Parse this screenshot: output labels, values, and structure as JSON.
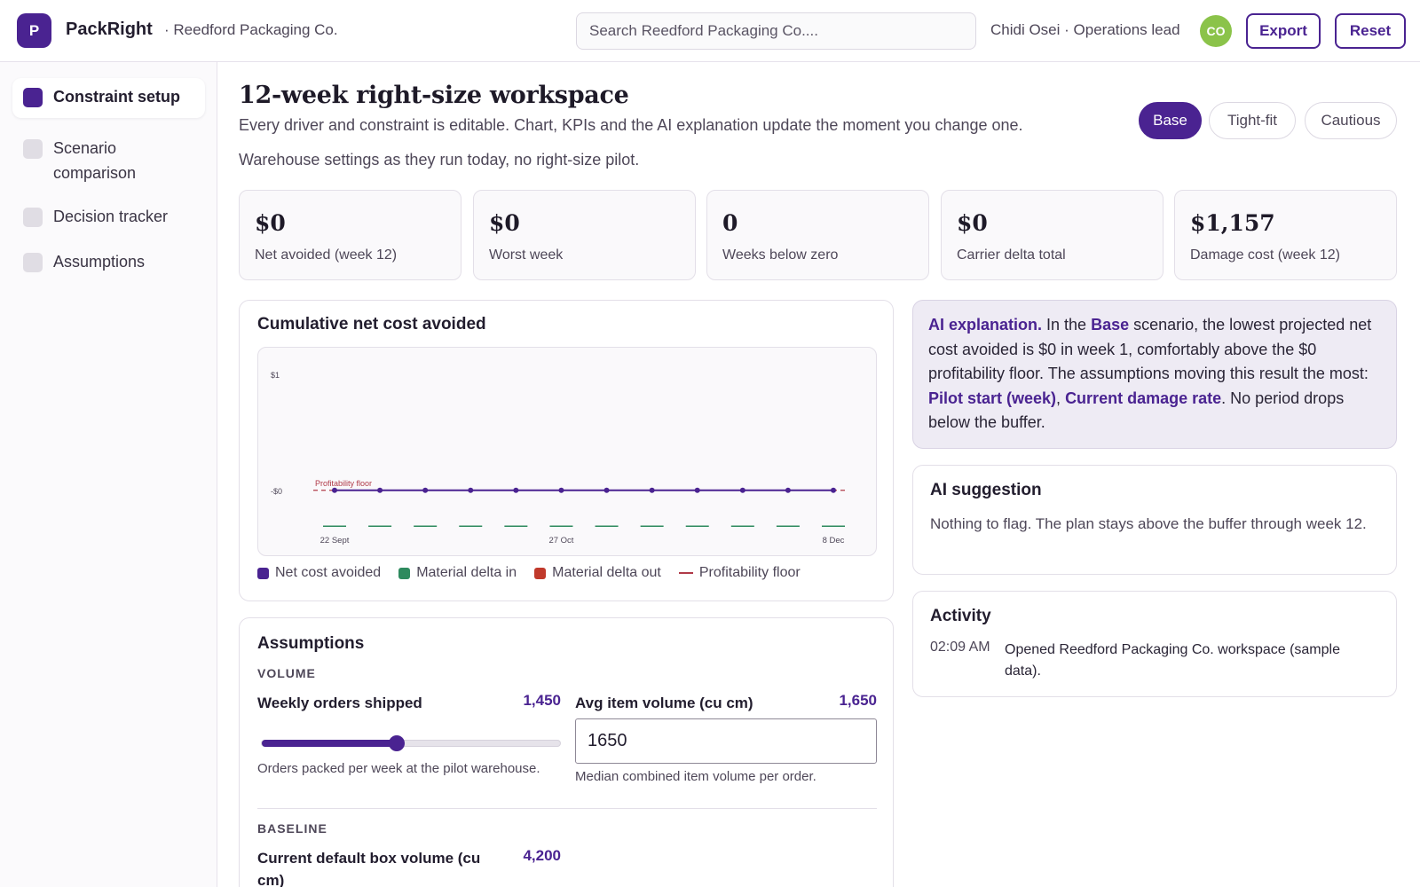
{
  "header": {
    "logo_letter": "P",
    "app_name": "PackRight",
    "org_name": "· Reedford Packaging Co.",
    "search_placeholder": "Search Reedford Packaging Co....",
    "user": "Chidi Osei · Operations lead",
    "avatar_initials": "CO",
    "export_label": "Export",
    "reset_label": "Reset"
  },
  "sidebar": {
    "items": [
      {
        "label": "Constraint setup",
        "active": true
      },
      {
        "label": "Scenario comparison",
        "active": false
      },
      {
        "label": "Decision tracker",
        "active": false
      },
      {
        "label": "Assumptions",
        "active": false
      }
    ]
  },
  "main": {
    "title": "12-week right-size workspace",
    "subtitle": "Every driver and constraint is editable. Chart, KPIs and the AI explanation update the moment you change one.",
    "scenario_description": "Warehouse settings as they run today, no right-size pilot.",
    "scenarios": [
      {
        "label": "Base",
        "active": true
      },
      {
        "label": "Tight-fit",
        "active": false
      },
      {
        "label": "Cautious",
        "active": false
      }
    ],
    "kpis": [
      {
        "value": "$0",
        "label": "Net avoided (week 12)"
      },
      {
        "value": "$0",
        "label": "Worst week"
      },
      {
        "value": "0",
        "label": "Weeks below zero"
      },
      {
        "value": "$0",
        "label": "Carrier delta total"
      },
      {
        "value": "$1,157",
        "label": "Damage cost (week 12)"
      }
    ]
  },
  "chart_card": {
    "title": "Cumulative net cost avoided",
    "legend": {
      "net": "Net cost avoided",
      "material_in": "Material delta in",
      "material_out": "Material delta out",
      "floor": "Profitability floor"
    }
  },
  "chart_data": {
    "type": "line",
    "title": "Cumulative net cost avoided",
    "x": [
      1,
      2,
      3,
      4,
      5,
      6,
      7,
      8,
      9,
      10,
      11,
      12
    ],
    "x_tick_labels": [
      "22 Sept",
      "27 Oct",
      "8 Dec"
    ],
    "x_tick_index": [
      1,
      6,
      12
    ],
    "y_tick_labels": [
      "$1",
      "-$0"
    ],
    "ylim": [
      -0.3,
      1
    ],
    "series": [
      {
        "name": "Net cost avoided",
        "type": "line",
        "color": "#4a2391",
        "values": [
          0,
          0,
          0,
          0,
          0,
          0,
          0,
          0,
          0,
          0,
          0,
          0
        ]
      },
      {
        "name": "Material delta in",
        "type": "bar",
        "color": "#2e8a5e",
        "values": [
          0,
          0,
          0,
          0,
          0,
          0,
          0,
          0,
          0,
          0,
          0,
          0
        ]
      },
      {
        "name": "Material delta out",
        "type": "bar",
        "color": "#c0392b",
        "values": [
          0,
          0,
          0,
          0,
          0,
          0,
          0,
          0,
          0,
          0,
          0,
          0
        ]
      }
    ],
    "reference_line": {
      "name": "Profitability floor",
      "label": "Profitability floor",
      "value": 0,
      "color": "#b03a48"
    },
    "grid": false
  },
  "assumptions": {
    "title": "Assumptions",
    "volume_label": "VOLUME",
    "weekly_orders": {
      "label": "Weekly orders shipped",
      "value": "1,450",
      "fraction": 0.45,
      "help": "Orders packed per week at the pilot warehouse."
    },
    "avg_item_volume": {
      "label": "Avg item volume (cu cm)",
      "value": "1,650",
      "input_value": "1650",
      "help": "Median combined item volume per order."
    },
    "baseline_label": "BASELINE",
    "default_box": {
      "label": "Current default box volume (cu cm)",
      "value": "4,200"
    }
  },
  "ai_explanation": {
    "lead": "AI explanation.",
    "t1": " In the ",
    "scenario": "Base",
    "t2": " scenario, the lowest projected net cost avoided is $0 in week 1, comfortably above the $0 profitability floor. The assumptions moving this result the most: ",
    "driver1": "Pilot start (week)",
    "sep": ", ",
    "driver2": "Current damage rate",
    "t3": ". No period drops below the buffer."
  },
  "ai_suggestion": {
    "title": "AI suggestion",
    "text": "Nothing to flag. The plan stays above the buffer through week 12."
  },
  "activity": {
    "title": "Activity",
    "items": [
      {
        "time": "02:09 AM",
        "text": "Opened Reedford Packaging Co. workspace (sample data)."
      }
    ]
  },
  "colors": {
    "accent": "#4a2391",
    "avatar": "#8bc34a",
    "material_in": "#2e8a5e",
    "material_out": "#c0392b",
    "floor": "#b03a48"
  }
}
